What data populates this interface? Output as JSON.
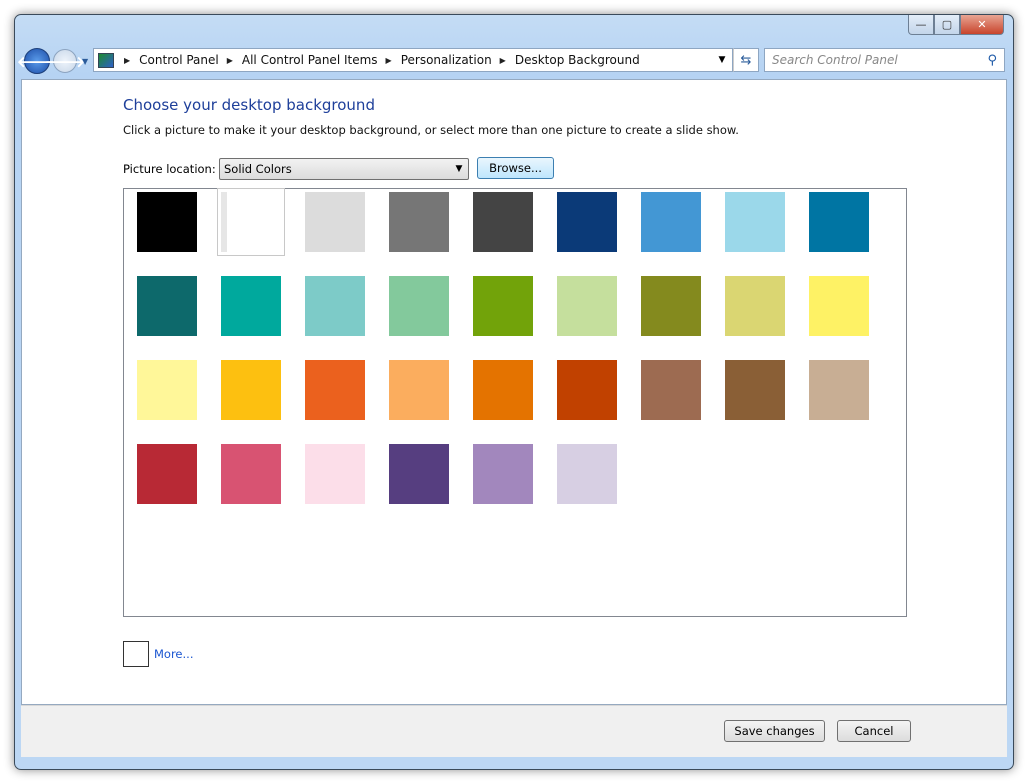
{
  "window": {
    "minimize": "—",
    "maximize": "▢",
    "close": "✕"
  },
  "nav": {
    "back": "🡐",
    "forward": "🡒"
  },
  "breadcrumb": [
    "Control Panel",
    "All Control Panel Items",
    "Personalization",
    "Desktop Background"
  ],
  "search": {
    "placeholder": "Search Control Panel"
  },
  "page": {
    "title": "Choose your desktop background",
    "subtitle": "Click a picture to make it your desktop background, or select more than one picture to create a slide show.",
    "location_label": "Picture location:",
    "location_value": "Solid Colors",
    "browse": "Browse...",
    "more": "More..."
  },
  "selected_index": 1,
  "colors": [
    "#000000",
    "#ffffff",
    "#dcdcdc",
    "#767676",
    "#444444",
    "#0b3a78",
    "#4397d4",
    "#9bd8ea",
    "#0075a3",
    "#0d696b",
    "#00a99d",
    "#7dcbc8",
    "#83c99c",
    "#72a30a",
    "#c5df9d",
    "#848a1e",
    "#dad672",
    "#fef265",
    "#fff799",
    "#fdc010",
    "#eb611e",
    "#fbad5e",
    "#e47300",
    "#c14100",
    "#9d6b51",
    "#8a5f36",
    "#c8ae94",
    "#b82935",
    "#d85372",
    "#fcdee9",
    "#563e80",
    "#a287bd",
    "#d7cfe3"
  ],
  "footer": {
    "save": "Save changes",
    "cancel": "Cancel"
  }
}
